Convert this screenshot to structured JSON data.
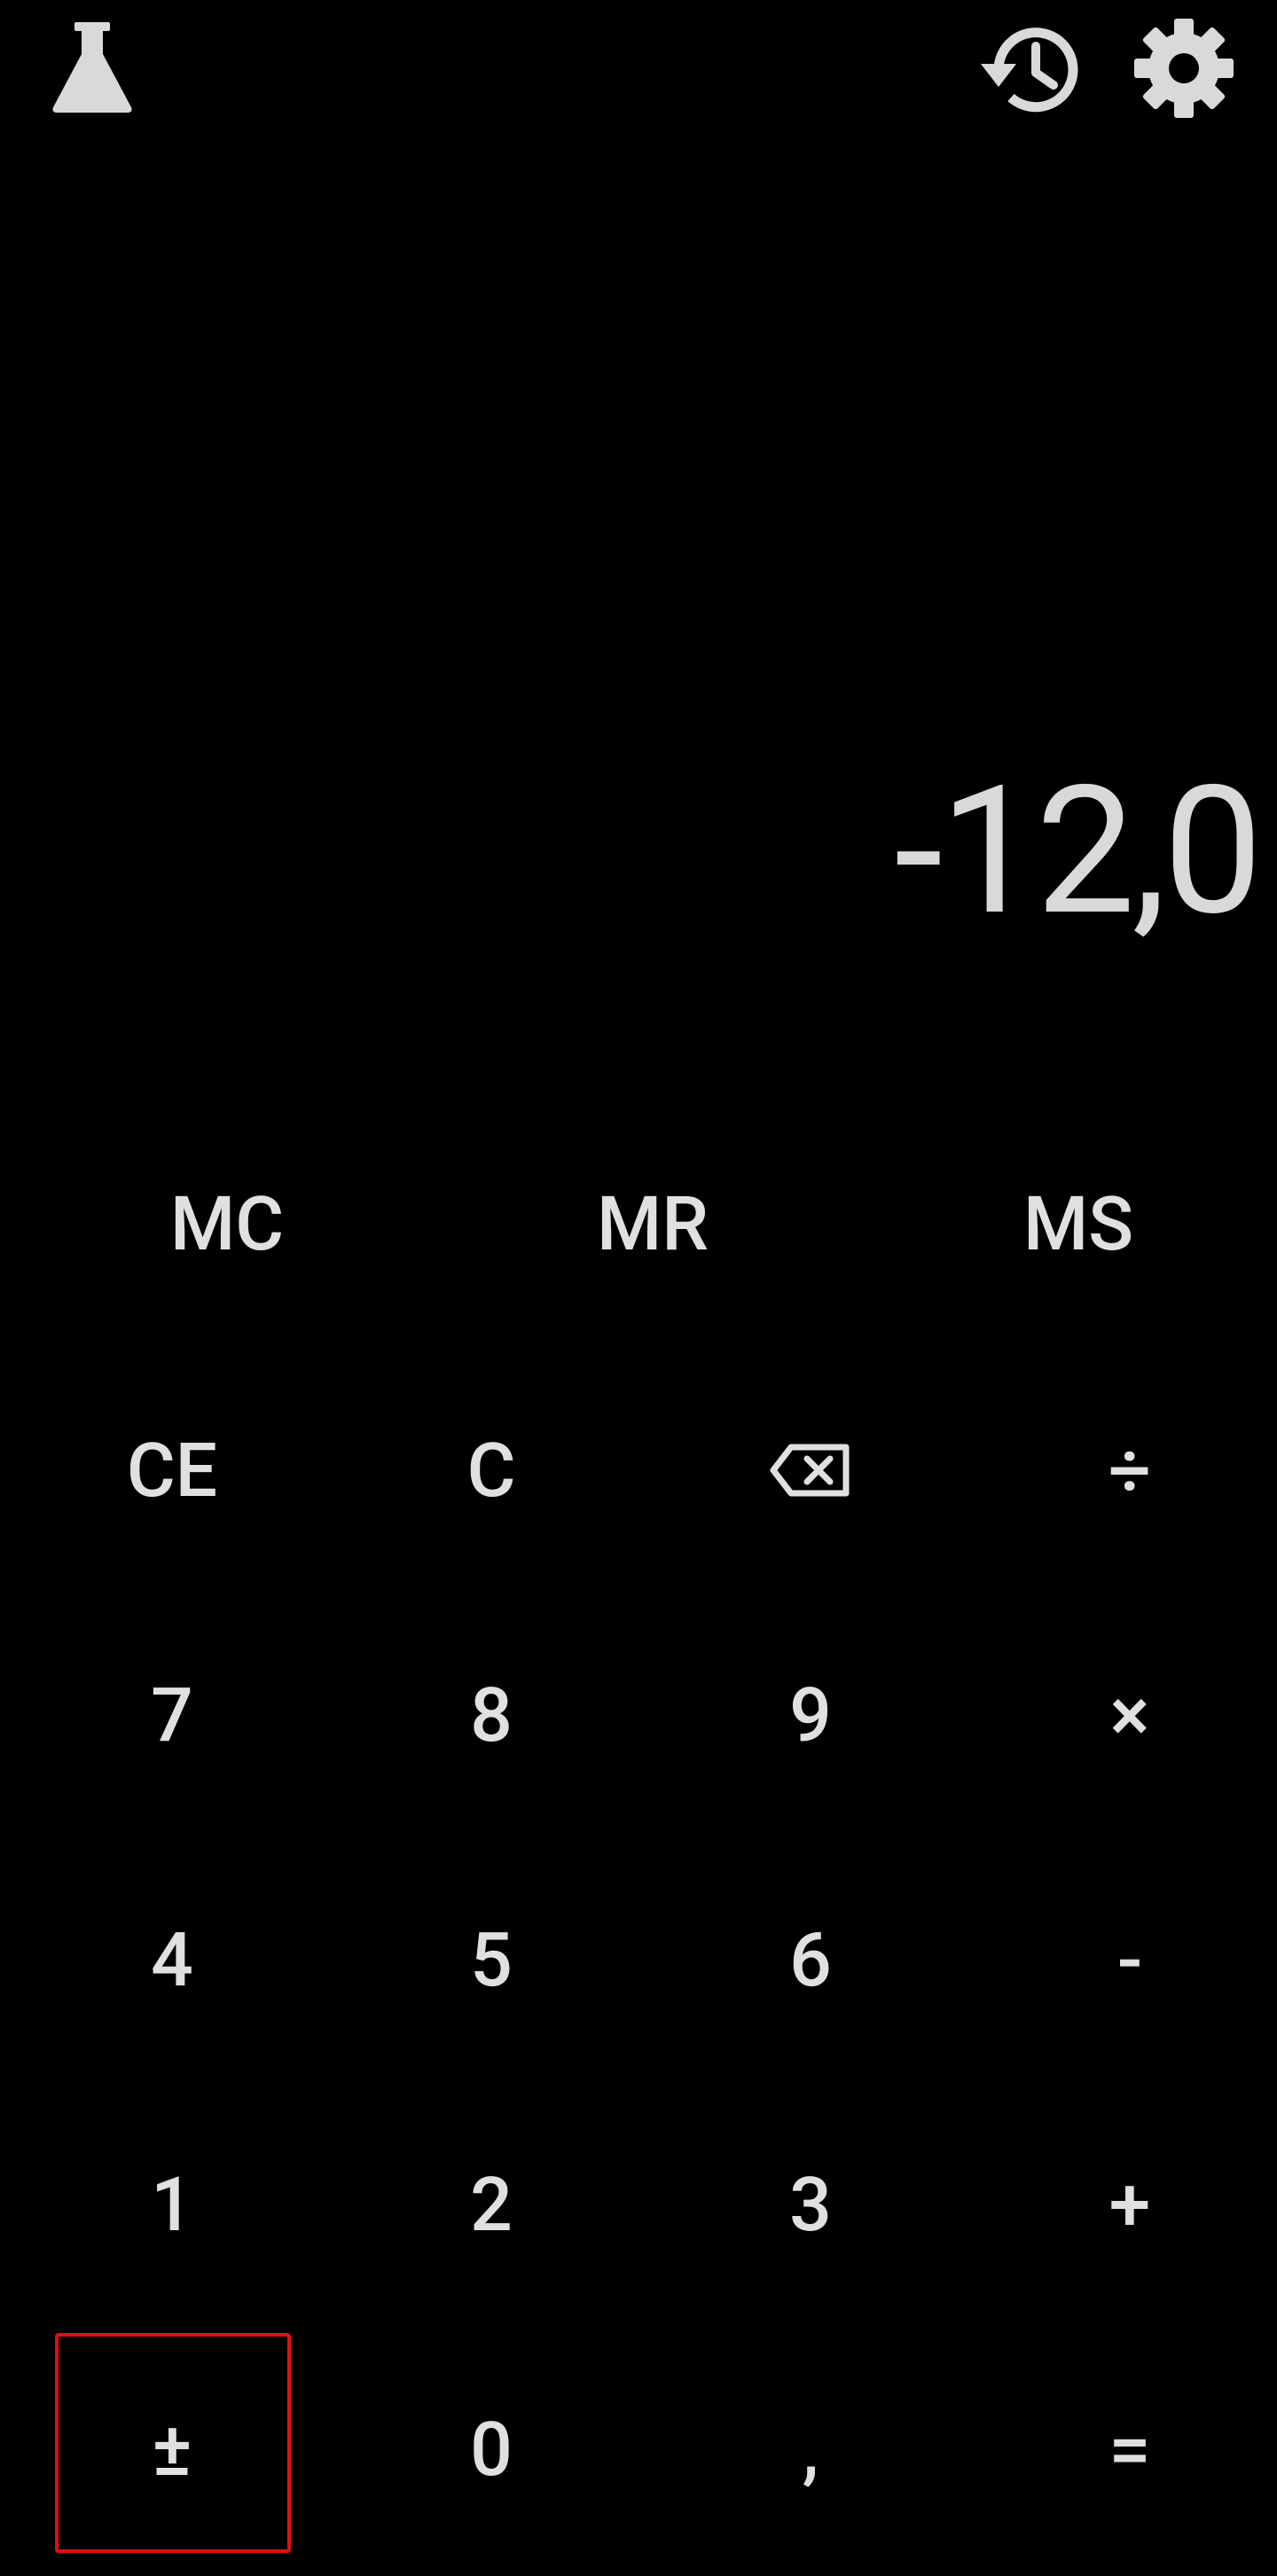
{
  "top_bar": {
    "left_icon": "flask-icon",
    "right_icons": [
      "history-icon",
      "settings-gear-icon"
    ]
  },
  "display": {
    "value": "-12,0"
  },
  "memory": [
    "MC",
    "MR",
    "MS"
  ],
  "keys": {
    "r0": [
      "CE",
      "C",
      "backspace",
      "÷"
    ],
    "r1": [
      "7",
      "8",
      "9",
      "×"
    ],
    "r2": [
      "4",
      "5",
      "6",
      "-"
    ],
    "r3": [
      "1",
      "2",
      "3",
      "+"
    ],
    "r4": [
      "±",
      "0",
      ",",
      "="
    ]
  },
  "highlight_color": "#e01010",
  "text_color": "#e0e0e0",
  "background_color": "#000000"
}
